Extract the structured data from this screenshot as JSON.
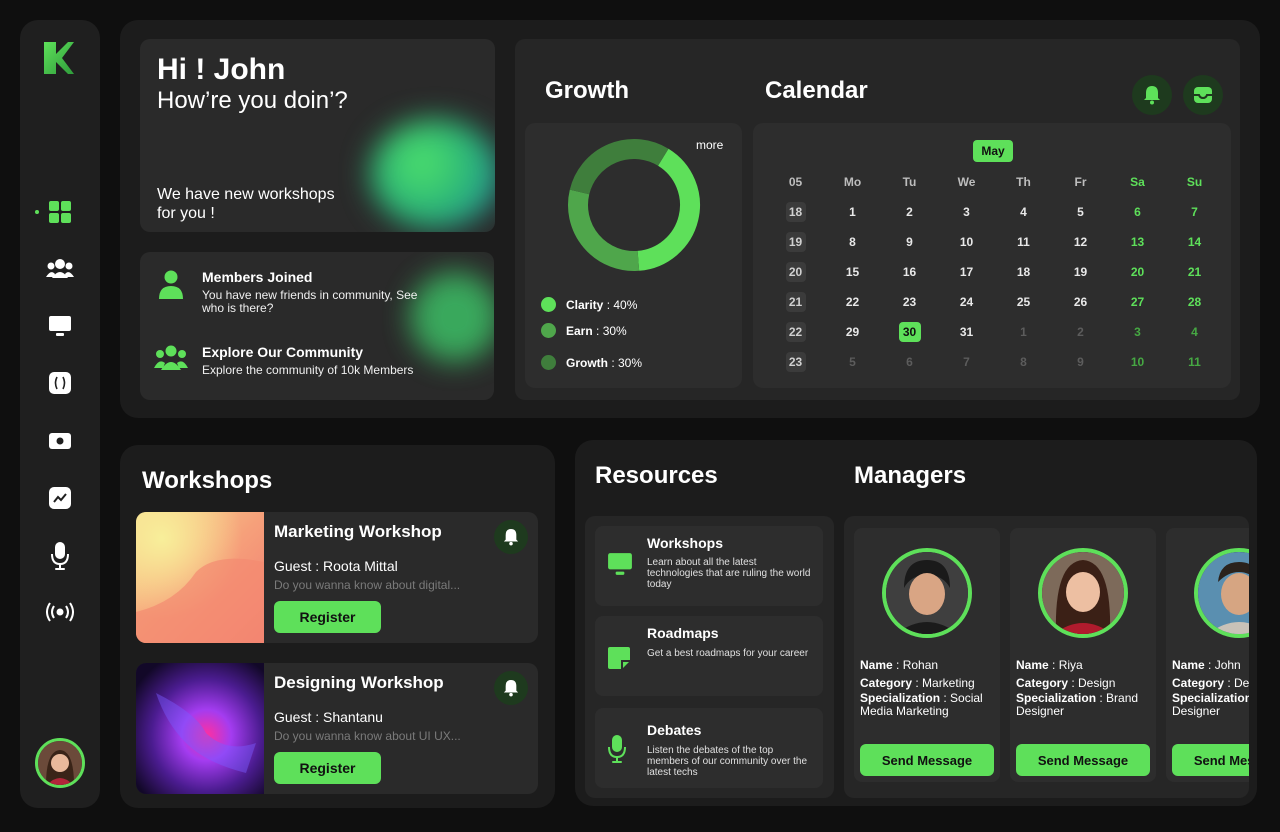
{
  "greeting": {
    "title": "Hi ! John",
    "subtitle": "How’re you doin’?",
    "note": "We have new workshops for you !"
  },
  "community": {
    "members_title": "Members Joined",
    "members_desc": "You have new friends in community, See who is there?",
    "explore_title": "Explore Our Community",
    "explore_desc": "Explore the community of 10k Members"
  },
  "growth": {
    "title": "Growth",
    "more_label": "more",
    "legend": [
      {
        "label": "Clarity",
        "value": " : 40%"
      },
      {
        "label": "Earn",
        "value": " : 30%"
      },
      {
        "label": "Growth",
        "value": " : 30%"
      }
    ]
  },
  "chart_data": {
    "type": "pie",
    "categories": [
      "Clarity",
      "Earn",
      "Growth"
    ],
    "values": [
      40,
      30,
      30
    ],
    "colors": [
      "#5ee05a",
      "#4fa64b",
      "#3f7e3c"
    ]
  },
  "calendar": {
    "title": "Calendar",
    "month": "May",
    "headers": [
      "05",
      "Mo",
      "Tu",
      "We",
      "Th",
      "Fr",
      "Sa",
      "Su"
    ],
    "rows": [
      [
        "18",
        "1",
        "2",
        "3",
        "4",
        "5",
        "6",
        "7"
      ],
      [
        "19",
        "8",
        "9",
        "10",
        "11",
        "12",
        "13",
        "14"
      ],
      [
        "20",
        "15",
        "16",
        "17",
        "18",
        "19",
        "20",
        "21"
      ],
      [
        "21",
        "22",
        "23",
        "24",
        "25",
        "26",
        "27",
        "28"
      ],
      [
        "22",
        "29",
        "30",
        "31",
        "1",
        "2",
        "3",
        "4"
      ],
      [
        "23",
        "5",
        "6",
        "7",
        "8",
        "9",
        "10",
        "11"
      ]
    ],
    "today": "30"
  },
  "icons": {
    "bell": "bell-icon",
    "inbox": "inbox-icon"
  },
  "workshops": {
    "title": "Workshops",
    "items": [
      {
        "title": "Marketing Workshop",
        "guest": "Guest : Roota Mittal",
        "desc": "Do you wanna know about digital...",
        "button": "Register"
      },
      {
        "title": "Designing Workshop",
        "guest": "Guest : Shantanu",
        "desc": "Do you wanna know about UI UX...",
        "button": "Register"
      }
    ]
  },
  "resources": {
    "title": "Resources",
    "items": [
      {
        "title": "Workshops",
        "desc": "Learn about all the latest technologies that are ruling the world today"
      },
      {
        "title": "Roadmaps",
        "desc": "Get a best roadmaps for your career"
      },
      {
        "title": "Debates",
        "desc": "Listen the debates of the top members of our community over the latest techs"
      }
    ]
  },
  "managers": {
    "title": "Managers",
    "name_label": "Name",
    "category_label": "Category",
    "spec_label": "Specialization",
    "button": "Send Message",
    "items": [
      {
        "name": " : Rohan",
        "category": " : Marketing",
        "spec": " : Social Media Marketing"
      },
      {
        "name": " : Riya",
        "category": " : Design",
        "spec": " : Brand Designer"
      },
      {
        "name": " : John",
        "category": " : Design",
        "spec": " : Designer"
      }
    ]
  }
}
